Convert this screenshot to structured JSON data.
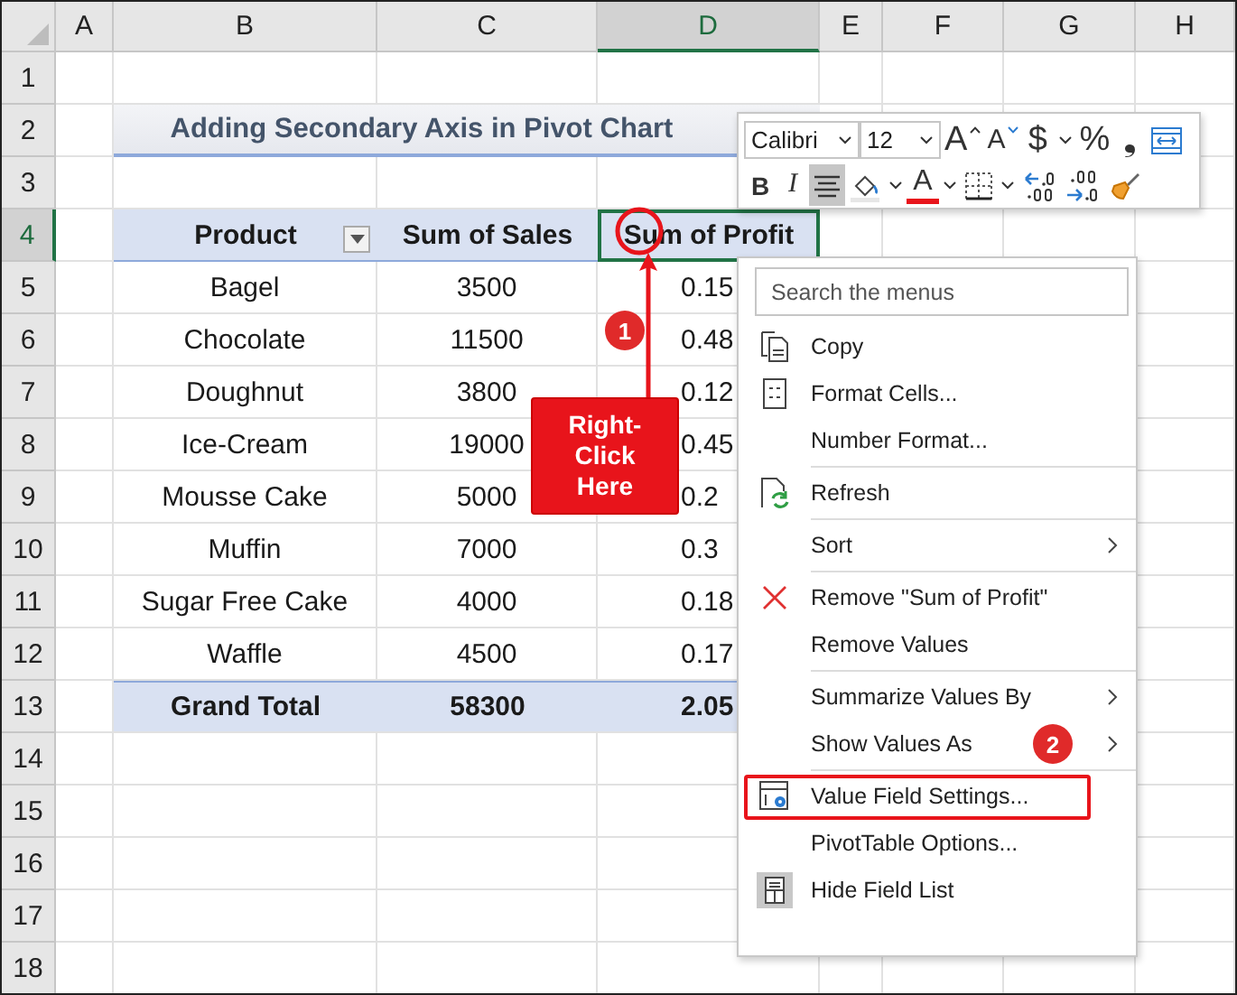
{
  "sheet": {
    "columns": [
      {
        "label": "A",
        "selected": false
      },
      {
        "label": "B",
        "selected": false
      },
      {
        "label": "C",
        "selected": false
      },
      {
        "label": "D",
        "selected": true
      },
      {
        "label": "E",
        "selected": false
      },
      {
        "label": "F",
        "selected": false
      },
      {
        "label": "G",
        "selected": false
      },
      {
        "label": "H",
        "selected": false
      }
    ],
    "row_numbers": [
      {
        "label": "1",
        "selected": false
      },
      {
        "label": "2",
        "selected": false
      },
      {
        "label": "3",
        "selected": false
      },
      {
        "label": "4",
        "selected": true
      },
      {
        "label": "5",
        "selected": false
      },
      {
        "label": "6",
        "selected": false
      },
      {
        "label": "7",
        "selected": false
      },
      {
        "label": "8",
        "selected": false
      },
      {
        "label": "9",
        "selected": false
      },
      {
        "label": "10",
        "selected": false
      },
      {
        "label": "11",
        "selected": false
      },
      {
        "label": "12",
        "selected": false
      },
      {
        "label": "13",
        "selected": false
      },
      {
        "label": "14",
        "selected": false
      },
      {
        "label": "15",
        "selected": false
      },
      {
        "label": "16",
        "selected": false
      },
      {
        "label": "17",
        "selected": false
      },
      {
        "label": "18",
        "selected": false
      }
    ]
  },
  "title": "Adding Secondary Axis in Pivot Chart",
  "pivot": {
    "headers": [
      "Product",
      "Sum of Sales",
      "Sum of Profit"
    ],
    "rows": [
      [
        "Bagel",
        "3500",
        "0.15"
      ],
      [
        "Chocolate",
        "11500",
        "0.48"
      ],
      [
        "Doughnut",
        "3800",
        "0.12"
      ],
      [
        "Ice-Cream",
        "19000",
        "0.45"
      ],
      [
        "Mousse Cake",
        "5000",
        "0.2"
      ],
      [
        "Muffin",
        "7000",
        "0.3"
      ],
      [
        "Sugar Free Cake",
        "4000",
        "0.18"
      ],
      [
        "Waffle",
        "4500",
        "0.17"
      ]
    ],
    "total": [
      "Grand Total",
      "58300",
      "2.05"
    ]
  },
  "mini_toolbar": {
    "font": "Calibri",
    "size": "12",
    "row1": [
      {
        "kind": "grow",
        "label": "A"
      },
      {
        "kind": "shrink",
        "label": "A"
      },
      {
        "kind": "glyph",
        "label": "$"
      },
      {
        "kind": "dropdown"
      },
      {
        "kind": "glyph",
        "label": "%"
      },
      {
        "kind": "glyph",
        "label": "❟"
      },
      {
        "kind": "wrap"
      }
    ],
    "row2": [
      {
        "kind": "bold",
        "label": "B",
        "selected": false
      },
      {
        "kind": "italic",
        "label": "I",
        "selected": false
      },
      {
        "kind": "align",
        "selected": true
      },
      {
        "kind": "fill"
      },
      {
        "kind": "dropdown"
      },
      {
        "kind": "fontcolor",
        "label": "A"
      },
      {
        "kind": "dropdown"
      },
      {
        "kind": "borders"
      },
      {
        "kind": "dropdown"
      },
      {
        "kind": "increase-decimal"
      },
      {
        "kind": "decrease-decimal"
      },
      {
        "kind": "painter"
      }
    ]
  },
  "context_menu": {
    "search": {
      "placeholder": "Search the menus"
    },
    "items": [
      {
        "kind": "copy",
        "label": "Copy",
        "submenu": false
      },
      {
        "kind": "format",
        "label": "Format Cells...",
        "submenu": false
      },
      {
        "kind": "plain",
        "label": "Number Format...",
        "submenu": false
      },
      {
        "kind": "separator"
      },
      {
        "kind": "refresh",
        "label": "Refresh",
        "submenu": false
      },
      {
        "kind": "separator"
      },
      {
        "kind": "plain",
        "label": "Sort",
        "submenu": true
      },
      {
        "kind": "separator"
      },
      {
        "kind": "remove",
        "label": "Remove \"Sum of Profit\"",
        "submenu": false
      },
      {
        "kind": "plain",
        "label": "Remove Values",
        "submenu": false
      },
      {
        "kind": "separator"
      },
      {
        "kind": "plain",
        "label": "Summarize Values By",
        "submenu": true
      },
      {
        "kind": "plain",
        "label": "Show Values As",
        "submenu": true,
        "badge": "2"
      },
      {
        "kind": "separator"
      },
      {
        "kind": "settings",
        "label": "Value Field Settings...",
        "submenu": false,
        "marked": true
      },
      {
        "kind": "plain",
        "label": "PivotTable Options...",
        "submenu": false
      },
      {
        "kind": "fieldlist",
        "label": "Hide Field List",
        "submenu": false
      }
    ]
  },
  "callout": {
    "text": "Right-\nClick\nHere",
    "badge": "1"
  }
}
